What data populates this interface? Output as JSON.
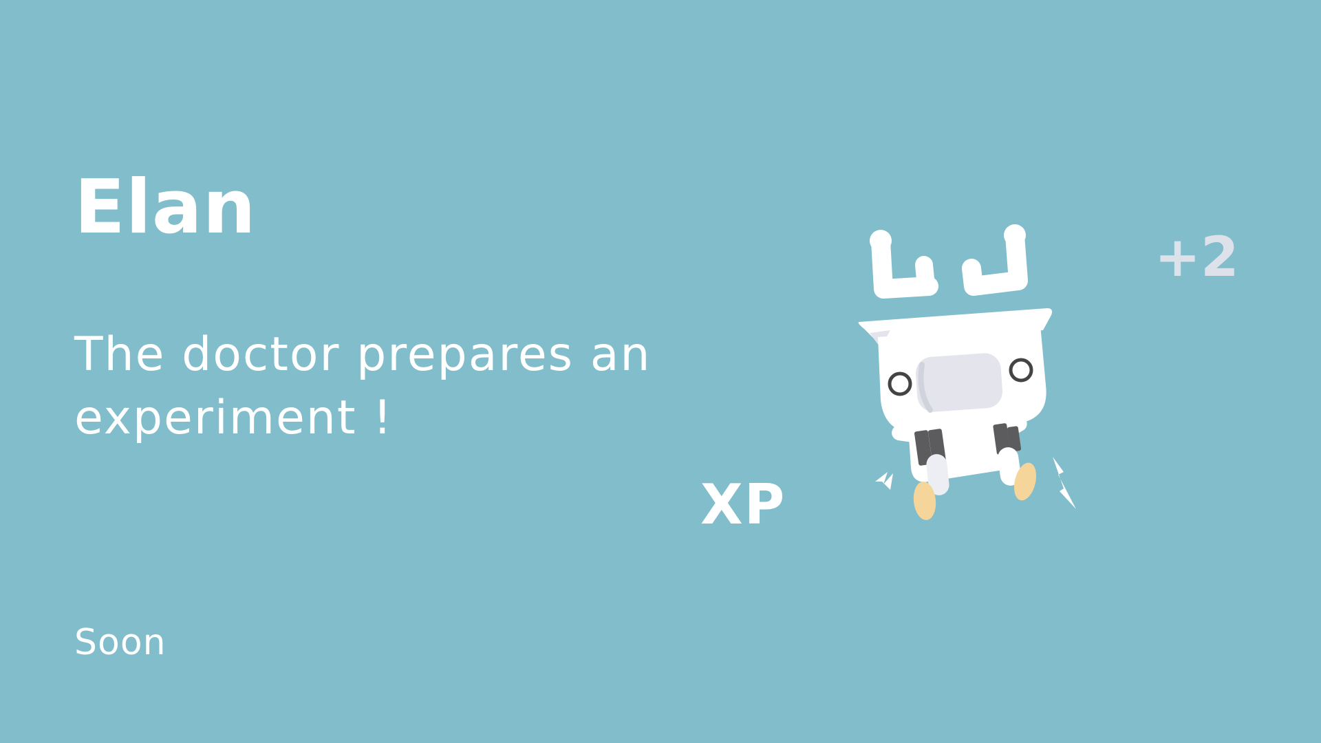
{
  "card": {
    "title": "Elan",
    "description": "The doctor prepares an experiment !",
    "status": "Soon"
  },
  "reward": {
    "label": "XP",
    "amount": "+2"
  },
  "mascot": {
    "icon": "robot-mascot-icon"
  },
  "colors": {
    "background": "#82bdcb",
    "text": "#ffffff",
    "reward_amount": "#dde1ea",
    "visor": "#e4e5ec",
    "joints": "#5c5c5e",
    "feet": "#f6d59a"
  }
}
